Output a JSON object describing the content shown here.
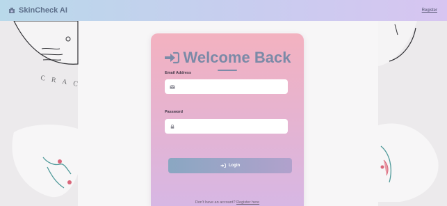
{
  "navbar": {
    "brand": "SkinCheck AI",
    "register_link": "Register"
  },
  "background": {
    "art_text": "CRAC"
  },
  "login_card": {
    "title": "Welcome Back",
    "email_label": "Email Address",
    "email_value": "",
    "password_label": "Password",
    "password_value": "",
    "login_button": "Login",
    "footer_prefix": "Don't have an account?",
    "footer_link": "Register here"
  },
  "icons": {
    "brand": "clinic-icon",
    "title": "sign-in-icon",
    "email": "envelope-icon",
    "password": "lock-icon",
    "button": "sign-in-icon"
  },
  "colors": {
    "card_top": "#f3b2c0",
    "card_bottom": "#d7b7e4",
    "accent": "#7b8aa7",
    "navbar_left": "#b9d9ea",
    "navbar_right": "#d7c5f1"
  }
}
